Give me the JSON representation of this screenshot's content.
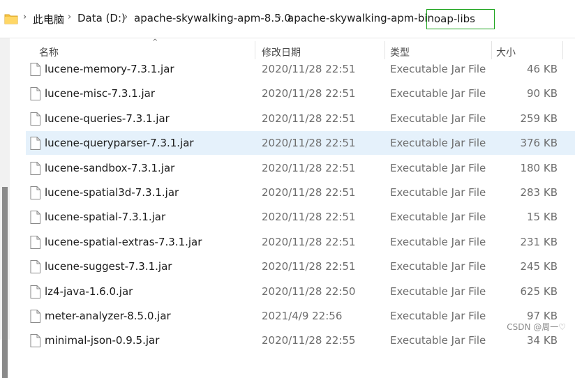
{
  "breadcrumb": {
    "items": [
      "此电脑",
      "Data (D:)",
      "apache-skywalking-apm-8.5.0",
      "apache-skywalking-apm-bin"
    ],
    "current": "oap-libs",
    "separator": "›"
  },
  "columns": {
    "name": "名称",
    "date": "修改日期",
    "type": "类型",
    "size": "大小",
    "sort_indicator": "^"
  },
  "files": [
    {
      "name": "lucene-memory-7.3.1.jar",
      "date": "2020/11/28 22:51",
      "type": "Executable Jar File",
      "size": "46 KB",
      "selected": false
    },
    {
      "name": "lucene-misc-7.3.1.jar",
      "date": "2020/11/28 22:51",
      "type": "Executable Jar File",
      "size": "90 KB",
      "selected": false
    },
    {
      "name": "lucene-queries-7.3.1.jar",
      "date": "2020/11/28 22:51",
      "type": "Executable Jar File",
      "size": "259 KB",
      "selected": false
    },
    {
      "name": "lucene-queryparser-7.3.1.jar",
      "date": "2020/11/28 22:51",
      "type": "Executable Jar File",
      "size": "376 KB",
      "selected": true
    },
    {
      "name": "lucene-sandbox-7.3.1.jar",
      "date": "2020/11/28 22:51",
      "type": "Executable Jar File",
      "size": "180 KB",
      "selected": false
    },
    {
      "name": "lucene-spatial3d-7.3.1.jar",
      "date": "2020/11/28 22:51",
      "type": "Executable Jar File",
      "size": "283 KB",
      "selected": false
    },
    {
      "name": "lucene-spatial-7.3.1.jar",
      "date": "2020/11/28 22:51",
      "type": "Executable Jar File",
      "size": "15 KB",
      "selected": false
    },
    {
      "name": "lucene-spatial-extras-7.3.1.jar",
      "date": "2020/11/28 22:51",
      "type": "Executable Jar File",
      "size": "231 KB",
      "selected": false
    },
    {
      "name": "lucene-suggest-7.3.1.jar",
      "date": "2020/11/28 22:51",
      "type": "Executable Jar File",
      "size": "245 KB",
      "selected": false
    },
    {
      "name": "lz4-java-1.6.0.jar",
      "date": "2020/11/28 22:50",
      "type": "Executable Jar File",
      "size": "625 KB",
      "selected": false
    },
    {
      "name": "meter-analyzer-8.5.0.jar",
      "date": "2021/4/9 22:56",
      "type": "Executable Jar File",
      "size": "97 KB",
      "selected": false
    },
    {
      "name": "minimal-json-0.9.5.jar",
      "date": "2020/11/28 22:55",
      "type": "Executable Jar File",
      "size": "34 KB",
      "selected": false
    }
  ],
  "watermark": "CSDN @周一♡",
  "colors": {
    "selected_row": "#e5f1fb",
    "current_crumb_border": "#1fa51f",
    "folder": "#f5c242"
  }
}
